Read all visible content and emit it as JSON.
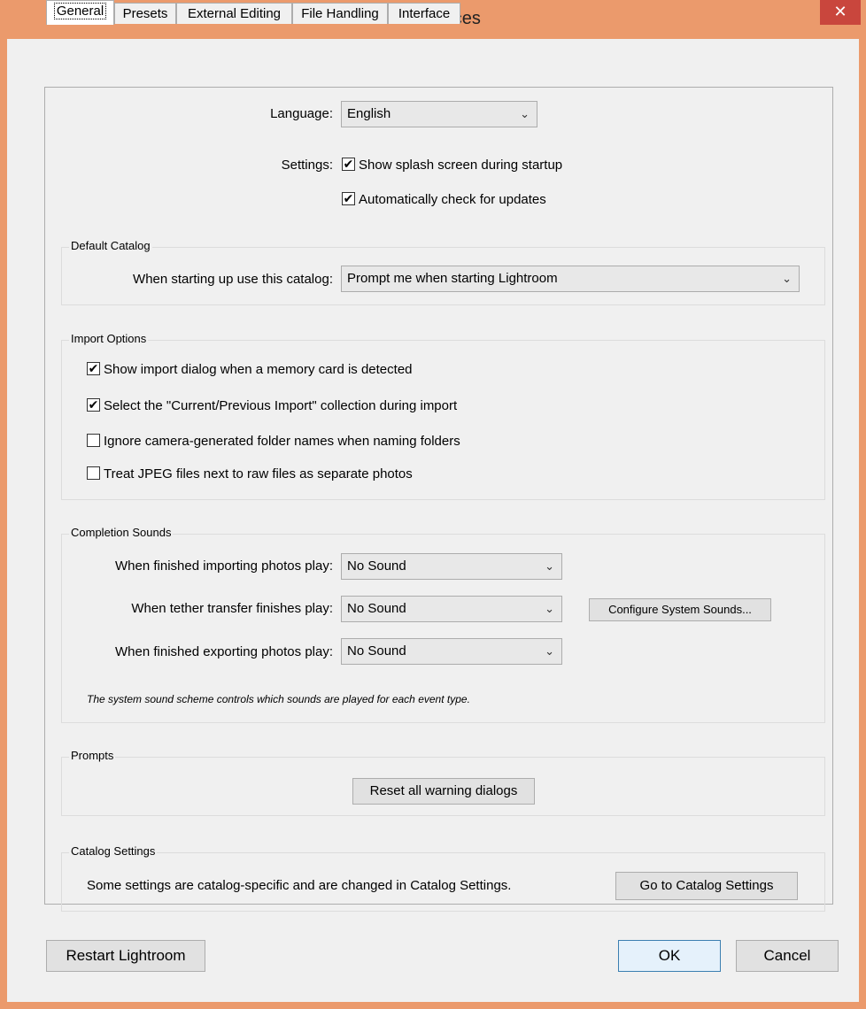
{
  "window": {
    "title": "Preferences",
    "close_glyph": "✕"
  },
  "tabs": [
    {
      "label": "General",
      "active": true
    },
    {
      "label": "Presets",
      "active": false
    },
    {
      "label": "External Editing",
      "active": false
    },
    {
      "label": "File Handling",
      "active": false
    },
    {
      "label": "Interface",
      "active": false
    }
  ],
  "general": {
    "language_label": "Language:",
    "language_value": "English",
    "settings_label": "Settings:",
    "show_splash": {
      "label": "Show splash screen during startup",
      "checked": true
    },
    "check_updates": {
      "label": "Automatically check for updates",
      "checked": true
    }
  },
  "default_catalog": {
    "title": "Default Catalog",
    "label": "When starting up use this catalog:",
    "value": "Prompt me when starting Lightroom"
  },
  "import_options": {
    "title": "Import Options",
    "items": [
      {
        "label": "Show import dialog when a memory card is detected",
        "checked": true
      },
      {
        "label": "Select the \"Current/Previous Import\" collection during import",
        "checked": true
      },
      {
        "label": "Ignore camera-generated folder names when naming folders",
        "checked": false
      },
      {
        "label": "Treat JPEG files next to raw files as separate photos",
        "checked": false
      }
    ]
  },
  "completion_sounds": {
    "title": "Completion Sounds",
    "importing_label": "When finished importing photos play:",
    "importing_value": "No Sound",
    "tether_label": "When tether transfer finishes play:",
    "tether_value": "No Sound",
    "exporting_label": "When finished exporting photos play:",
    "exporting_value": "No Sound",
    "configure_button": "Configure System Sounds...",
    "note": "The system sound scheme controls which sounds are played for each event type."
  },
  "prompts": {
    "title": "Prompts",
    "reset_button": "Reset all warning dialogs"
  },
  "catalog_settings": {
    "title": "Catalog Settings",
    "text": "Some settings are catalog-specific and are changed in Catalog Settings.",
    "button": "Go to Catalog Settings"
  },
  "footer": {
    "restart": "Restart Lightroom",
    "ok": "OK",
    "cancel": "Cancel"
  },
  "check_glyph": "✔",
  "chevron_glyph": "⌄"
}
